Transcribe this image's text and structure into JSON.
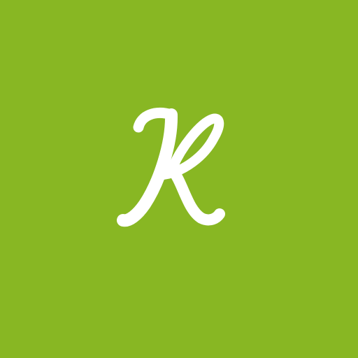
{
  "app_icon": {
    "letter": "K",
    "background_color": "#88b723",
    "glyph_color": "#ffffff",
    "icon": "script-letter-k-logo"
  }
}
